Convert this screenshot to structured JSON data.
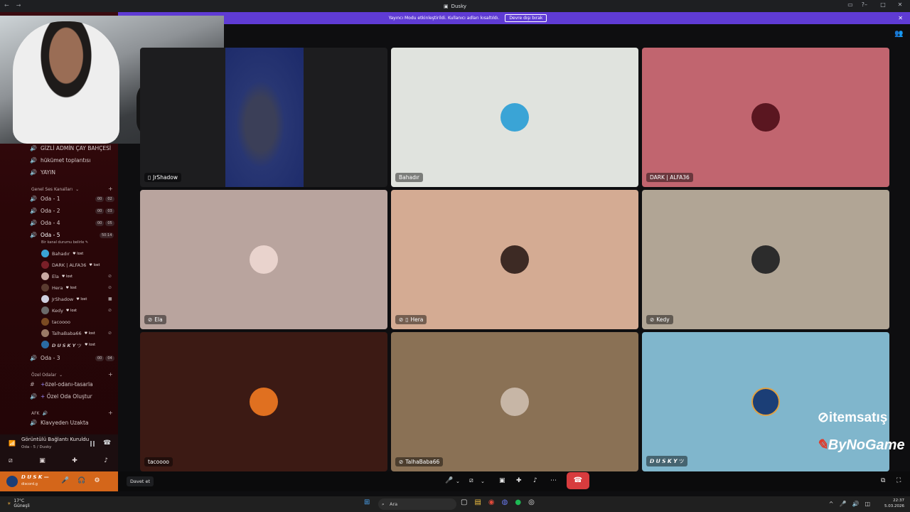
{
  "app": {
    "title": "Dusky"
  },
  "banner": {
    "text": "Yayıncı Modu etkinleştirildi. Kullanıcı adları kısaltıldı.",
    "button": "Devre dışı bırak"
  },
  "sidebar": {
    "channels": [
      {
        "name": "GİZLİ ADMİN ÇAY BAHÇESİ"
      },
      {
        "name": "hükümet toplantısı"
      },
      {
        "name": "YAYIN"
      }
    ],
    "voice_category": "Genel Ses Kanalları",
    "voice_channels": [
      {
        "name": "Oda - 1",
        "b1": "00",
        "b2": "02"
      },
      {
        "name": "Oda - 2",
        "b1": "00",
        "b2": "03"
      },
      {
        "name": "Oda - 4",
        "b1": "00",
        "b2": "05"
      },
      {
        "name": "Oda - 5",
        "time": "50:14",
        "status": "Bir kanal durumu belirle"
      }
    ],
    "members": [
      {
        "name": "Bahadır",
        "tag": "lost",
        "color": "#3aa4d6"
      },
      {
        "name": "DARK | ALFA36",
        "tag": "lost",
        "color": "#7a1f28"
      },
      {
        "name": "Ela",
        "tag": "lost",
        "color": "#c9a9a2"
      },
      {
        "name": "Hera",
        "tag": "lost",
        "color": "#5a3b30"
      },
      {
        "name": "JrShadow",
        "tag": "lost",
        "color": "#cfcfe0"
      },
      {
        "name": "Kedy",
        "tag": "lost",
        "color": "#6a6a6a"
      },
      {
        "name": "tacoooo",
        "tag": "",
        "color": "#7a4a22"
      },
      {
        "name": "TalhaBaba66",
        "tag": "lost",
        "color": "#9a7a66"
      },
      {
        "name": "𝘿 𝙐 𝙎 𝙆 𝙔 ツ",
        "tag": "lost",
        "color": "#2a6aa4"
      }
    ],
    "oda3": {
      "name": "Oda - 3",
      "b1": "00",
      "b2": "04"
    },
    "private_category": "Özel Odalar",
    "private_channels": [
      {
        "name": "özel-odanı-tasarla"
      },
      {
        "name": "Özel Oda Oluştur"
      }
    ],
    "afk_category": "AFK",
    "afk_channel": "Klavyeden Uzakta"
  },
  "voice_panel": {
    "title": "Görüntülü Bağlantı Kuruldu",
    "subtitle": "Oda - 5 / Dusky"
  },
  "user_panel": {
    "name": "𝘿 𝙐 𝙎 𝙆 —",
    "status": "discord.g"
  },
  "tiles": [
    {
      "name": "JrShadow",
      "bg": "#1d1d1f"
    },
    {
      "name": "Bahadır",
      "bg": "#e0e3de",
      "av": "#3aa4d6"
    },
    {
      "name": "DARK | ALFA36",
      "bg": "#c1656f",
      "av": "#5a1620"
    },
    {
      "name": "Ela",
      "bg": "#b9a49e",
      "av": "#e9d3cd"
    },
    {
      "name": "Hera",
      "bg": "#d4ab93",
      "av": "#3d2a24"
    },
    {
      "name": "Kedy",
      "bg": "#b1a595",
      "av": "#2c2c2c"
    },
    {
      "name": "tacoooo",
      "bg": "#3c1a14",
      "av": "#e07020"
    },
    {
      "name": "TalhaBaba66",
      "bg": "#8a7155",
      "av": "#c7b6a6"
    },
    {
      "name": "𝘿 𝙐 𝙎 𝙆 𝙔 ツ",
      "bg": "#80b6cc",
      "av": "#1b3e76"
    }
  ],
  "overlay": {
    "brand1": "itemsatış",
    "brand2": "ByNoGame"
  },
  "controlbar": {
    "invite": "Davet et"
  },
  "taskbar": {
    "temp": "17°C",
    "weather": "Güneşli",
    "search": "Ara",
    "time": "22:37",
    "date": "5.03.2026"
  }
}
